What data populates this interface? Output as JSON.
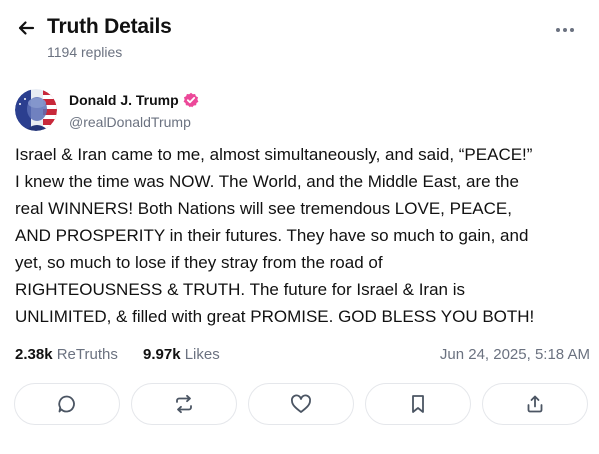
{
  "header": {
    "title": "Truth Details",
    "reply_count": "1194 replies",
    "back_icon": "arrow-left-icon",
    "more_icon": "ellipsis-icon"
  },
  "author": {
    "name": "Donald J. Trump",
    "handle": "@realDonaldTrump",
    "verified_color": "#ec4899"
  },
  "post": {
    "lines": [
      "Israel & Iran came to me, almost simultaneously, and said, “PEACE!”",
      "I knew the time was NOW. The World, and the Middle East, are the",
      "real WINNERS! Both Nations will see tremendous LOVE, PEACE,",
      "AND PROSPERITY in their futures. They have so much to gain, and",
      "yet, so much to lose if they stray from the road of",
      "RIGHTEOUSNESS & TRUTH. The future for Israel & Iran is",
      "UNLIMITED, & filled with great PROMISE. GOD BLESS YOU BOTH!"
    ]
  },
  "stats": {
    "retruths_count": "2.38k",
    "retruths_label": "ReTruths",
    "likes_count": "9.97k",
    "likes_label": "Likes",
    "timestamp": "Jun 24, 2025, 5:18 AM"
  },
  "actions": [
    {
      "icon": "reply-icon"
    },
    {
      "icon": "retruth-icon"
    },
    {
      "icon": "heart-icon"
    },
    {
      "icon": "bookmark-icon"
    },
    {
      "icon": "share-icon"
    }
  ],
  "colors": {
    "text": "#111111",
    "muted": "#6b7280",
    "border": "#e5e7eb",
    "icon": "#4b5563"
  }
}
